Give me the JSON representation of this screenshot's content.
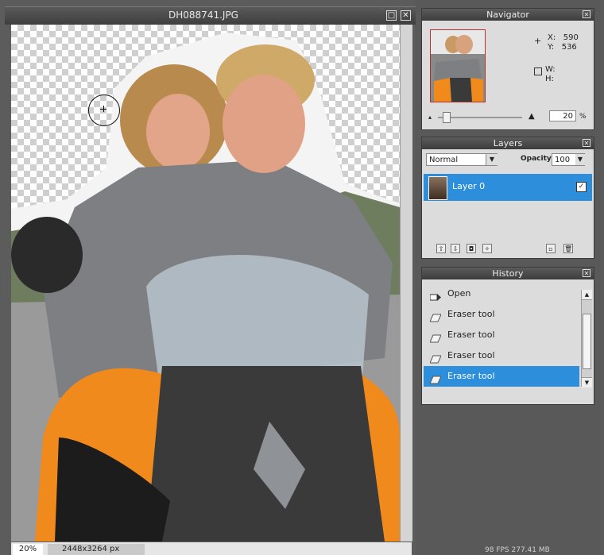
{
  "document": {
    "title": "DH088741.JPG",
    "zoom": "20%",
    "dimensions": "2448x3264 px"
  },
  "status": {
    "fps_memory": "98 FPS 277.41 MB"
  },
  "navigator": {
    "title": "Navigator",
    "x_label": "X:",
    "x_value": "590",
    "y_label": "Y:",
    "y_value": "536",
    "w_label": "W:",
    "h_label": "H:",
    "zoom_value": "20",
    "zoom_unit": "%"
  },
  "layers": {
    "title": "Layers",
    "blend_mode": "Normal",
    "opacity_label": "Opacity:",
    "opacity_value": "100",
    "items": [
      {
        "name": "Layer 0",
        "visible": true
      }
    ]
  },
  "history": {
    "title": "History",
    "items": [
      {
        "label": "Open",
        "icon": "open-icon"
      },
      {
        "label": "Eraser tool",
        "icon": "eraser-icon"
      },
      {
        "label": "Eraser tool",
        "icon": "eraser-icon"
      },
      {
        "label": "Eraser tool",
        "icon": "eraser-icon"
      },
      {
        "label": "Eraser tool",
        "icon": "eraser-icon",
        "selected": true
      }
    ]
  },
  "colors": {
    "selection": "#2d8fdc",
    "accent_orange": "#f08a1c"
  }
}
